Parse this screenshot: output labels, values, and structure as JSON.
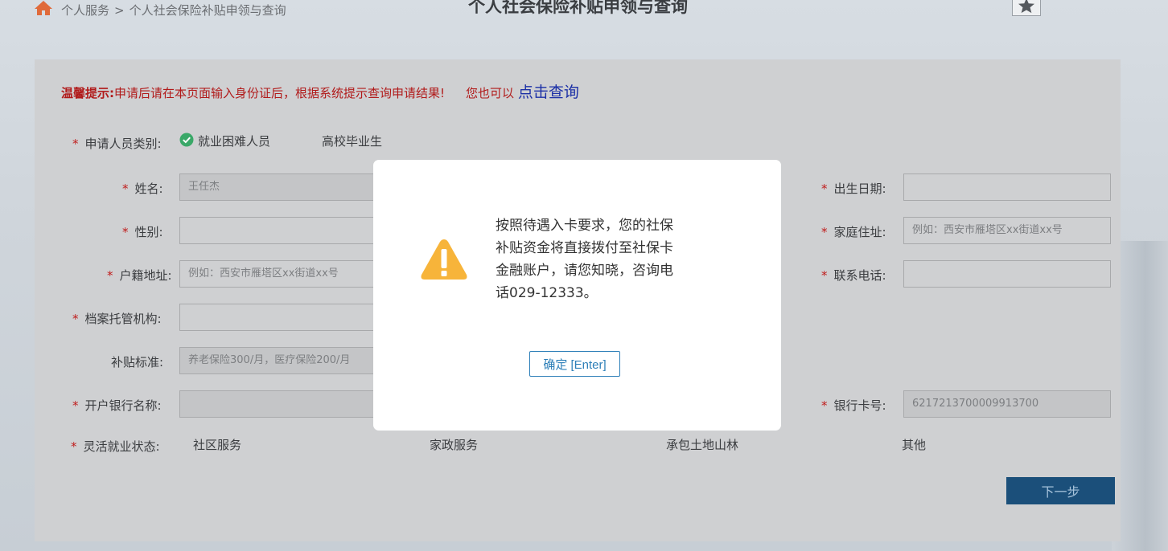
{
  "breadcrumb": {
    "home": "个人服务",
    "separator": ">",
    "current": "个人社会保险补贴申领与查询"
  },
  "page_title": "个人社会保险补贴申领与查询",
  "tip": {
    "label": "温馨提示:",
    "text": "申请后请在本页面输入身份证后，根据系统提示查询申请结果!",
    "extra": "您也可以",
    "link": "点击查询"
  },
  "form": {
    "required_mark": "*",
    "applicant_type_label": "申请人员类别:",
    "applicant_type_options": [
      "就业困难人员",
      "高校毕业生"
    ],
    "name_label": "姓名:",
    "name_value": "王任杰",
    "birth_date_label": "出生日期:",
    "gender_label": "性别:",
    "home_address_label": "家庭住址:",
    "home_address_placeholder": "例如：西安市雁塔区xx街道xx号",
    "household_address_label": "户籍地址:",
    "household_address_placeholder": "例如：西安市雁塔区xx街道xx号",
    "phone_label": "联系电话:",
    "archive_org_label": "档案托管机构:",
    "subsidy_label": "补贴标准:",
    "subsidy_placeholder": "养老保险300/月，医疗保险200/月",
    "bank_name_label": "开户银行名称:",
    "card_no_label": "银行卡号:",
    "card_no_value": "6217213700009913700",
    "employment_label": "灵活就业状态:",
    "employment_options": [
      "社区服务",
      "家政服务",
      "承包土地山林",
      "其他"
    ],
    "next_label": "下一步"
  },
  "modal": {
    "message_lines": [
      "按照待遇入卡要求，您的社保",
      "补贴资金将直接拨付至社保卡",
      "金融账户，请您知晓，咨询电",
      "话029-12333。"
    ],
    "ok_label": "确定 [Enter]"
  },
  "colors": {
    "accent": "#2d7fb8",
    "warning": "#f7b43a",
    "required": "#c01c1c",
    "next_button": "#1b4f7a"
  },
  "icons": {
    "home": "home-icon",
    "favorite": "star-icon",
    "check": "check-circle-icon",
    "warning": "warning-triangle-icon",
    "dropdown": "chevron-down-icon"
  }
}
